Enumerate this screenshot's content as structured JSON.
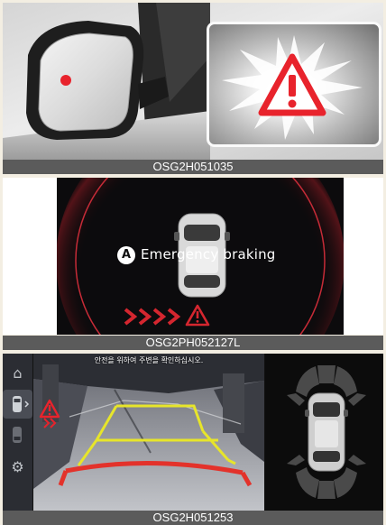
{
  "captions": {
    "mirror": "OSG2H051035",
    "cluster": "OSG2PH052127L",
    "camera": "OSG2H051253"
  },
  "cluster": {
    "marker": "A",
    "warning_text": "Emergency braking"
  },
  "camera": {
    "safety_message": "안전을 위하여 주변을 확인하십시오."
  },
  "colors": {
    "warning_red": "#e8232c",
    "guide_yellow": "#e7e52a",
    "guide_red": "#e3322b",
    "caption_bar": "#5b5b5b"
  },
  "icons": {
    "home": "home-icon",
    "parking_view": "parking-view-icon",
    "settings": "settings-icon",
    "warning": "warning-triangle-icon"
  }
}
